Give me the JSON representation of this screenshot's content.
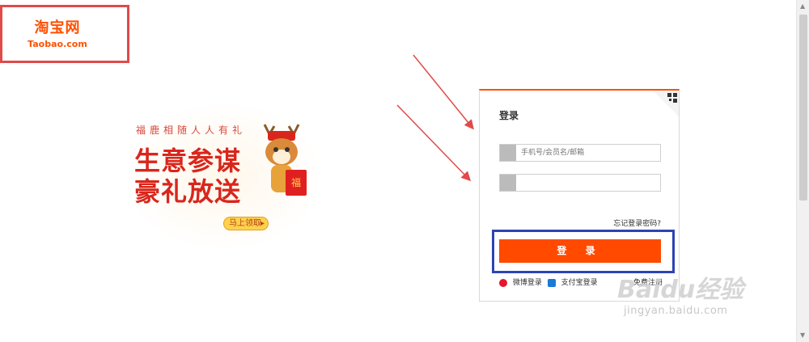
{
  "logo": {
    "cn": "淘宝网",
    "en": "Taobao.com"
  },
  "promo": {
    "tagline": "福鹿相随人人有礼",
    "line1": "生意参谋",
    "line2": "豪礼放送",
    "button": "马上领取"
  },
  "login": {
    "title": "登录",
    "username_placeholder": "手机号/会员名/邮箱",
    "password_placeholder": "",
    "forgot": "忘记登录密码?",
    "submit": "登 录",
    "weibo": "微博登录",
    "alipay": "支付宝登录",
    "register": "免费注册"
  },
  "watermark": {
    "brand": "Baidu经验",
    "url": "jingyan.baidu.com"
  },
  "colors": {
    "brand": "#ff5000",
    "annotation_red": "#e04a4a",
    "annotation_blue": "#2c44b5",
    "button": "#ff4a00"
  }
}
